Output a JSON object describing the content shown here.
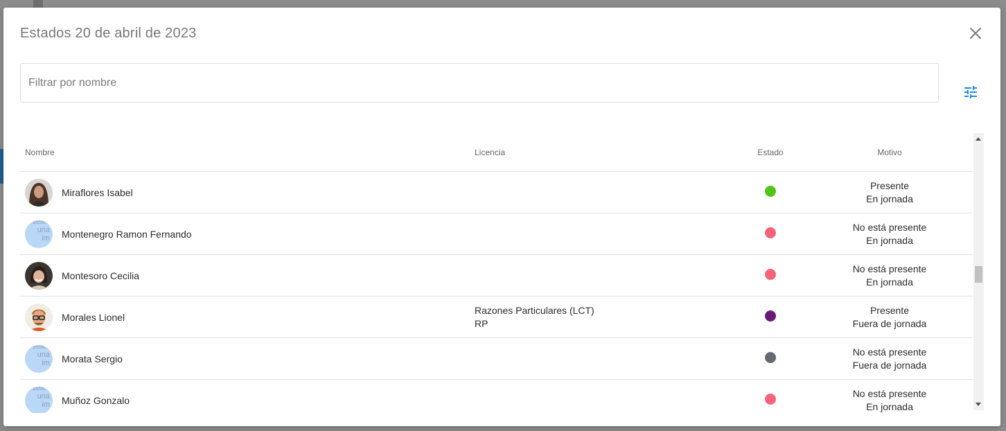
{
  "modal": {
    "title": "Estados 20 de abril de 2023"
  },
  "filter": {
    "placeholder": "Filtrar por nombre",
    "value": ""
  },
  "icons": {
    "close": "close-icon",
    "filter_settings": "tune-icon"
  },
  "colors": {
    "accent": "#1e88e5",
    "present": "#52c41a",
    "absent": "#f5647a",
    "license": "#6a1b7a",
    "off_shift": "#646b73"
  },
  "table": {
    "columns": [
      "Nombre",
      "Licencia",
      "Estado",
      "Motivo"
    ],
    "rows": [
      {
        "name": "Miraflores Isabel",
        "avatar": "photo",
        "license_line1": "",
        "license_line2": "",
        "status_color": "#52c41a",
        "motivo_line1": "Presente",
        "motivo_line2": "En jornada"
      },
      {
        "name": "Montenegro Ramon Fernando",
        "avatar": "placeholder",
        "license_line1": "",
        "license_line2": "",
        "status_color": "#f5647a",
        "motivo_line1": "No está presente",
        "motivo_line2": "En jornada"
      },
      {
        "name": "Montesoro Cecilia",
        "avatar": "photo",
        "license_line1": "",
        "license_line2": "",
        "status_color": "#f5647a",
        "motivo_line1": "No está presente",
        "motivo_line2": "En jornada"
      },
      {
        "name": "Morales Lionel",
        "avatar": "photo",
        "license_line1": "Razones Particulares (LCT)",
        "license_line2": "RP",
        "status_color": "#6a1b7a",
        "motivo_line1": "Presente",
        "motivo_line2": "Fuera de jornada"
      },
      {
        "name": "Morata Sergio",
        "avatar": "placeholder",
        "license_line1": "",
        "license_line2": "",
        "status_color": "#646b73",
        "motivo_line1": "No está presente",
        "motivo_line2": "Fuera de jornada"
      },
      {
        "name": "Muñoz Gonzalo",
        "avatar": "placeholder",
        "license_line1": "",
        "license_line2": "",
        "status_color": "#f5647a",
        "motivo_line1": "No está presente",
        "motivo_line2": "En jornada"
      }
    ]
  }
}
